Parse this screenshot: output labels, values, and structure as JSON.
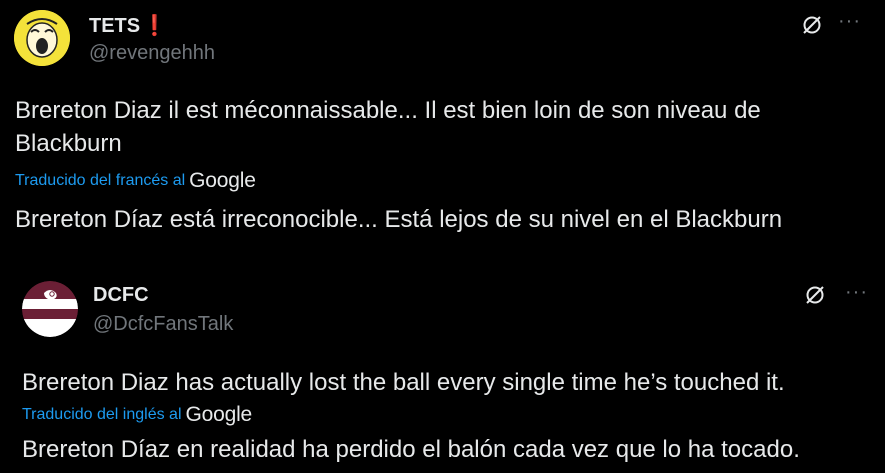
{
  "tweets": [
    {
      "name": "TETS",
      "badge": "❗",
      "handle": "@revengehhh",
      "original": "Brereton Diaz il est méconnaissable... Il est bien loin de son niveau de Blackburn",
      "translated_label": "Traducido del francés al",
      "translation_provider": "Google",
      "translation": "Brereton Díaz está irreconocible... Está lejos de su nivel en el Blackburn",
      "avatar_icon": "screaming-face-icon"
    },
    {
      "name": "DCFC",
      "handle": "@DcfcFansTalk",
      "original": "Brereton Diaz has actually lost the ball every single time he’s touched it.",
      "translated_label": "Traducido del inglés al",
      "translation_provider": "Google",
      "translation": "Brereton Díaz en realidad ha perdido el balón cada vez que lo ha tocado.",
      "avatar_icon": "ram-crest-icon"
    }
  ],
  "more_icon_glyph": "···",
  "colors": {
    "accent": "#1d9bf0",
    "text": "#e7e9ea",
    "muted": "#71767b",
    "background": "#000000"
  }
}
